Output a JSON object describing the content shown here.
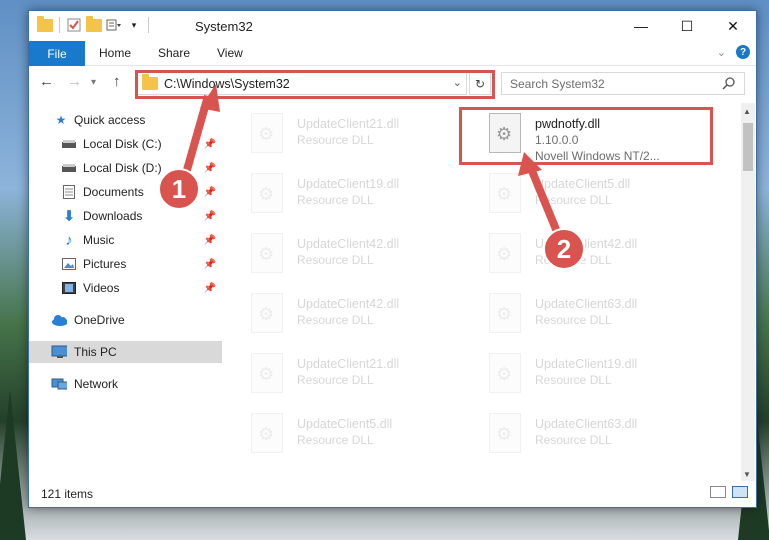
{
  "window": {
    "title": "System32",
    "controls": {
      "minimize": "—",
      "maximize": "☐",
      "close": "✕"
    }
  },
  "ribbon": {
    "tabs": [
      "File",
      "Home",
      "Share",
      "View"
    ],
    "help_label": "?"
  },
  "navigation": {
    "address": "C:\\Windows\\System32",
    "search_placeholder": "Search System32"
  },
  "sidebar": {
    "items": [
      {
        "label": "Quick access",
        "icon": "star-icon"
      },
      {
        "label": "Local Disk (C:)",
        "icon": "drive-icon"
      },
      {
        "label": "Local Disk (D:)",
        "icon": "drive-icon"
      },
      {
        "label": "Documents",
        "icon": "documents-icon"
      },
      {
        "label": "Downloads",
        "icon": "download-icon"
      },
      {
        "label": "Music",
        "icon": "music-icon"
      },
      {
        "label": "Pictures",
        "icon": "pictures-icon"
      },
      {
        "label": "Videos",
        "icon": "videos-icon"
      },
      {
        "label": "OneDrive",
        "icon": "cloud-icon"
      },
      {
        "label": "This PC",
        "icon": "computer-icon"
      },
      {
        "label": "Network",
        "icon": "network-icon"
      }
    ]
  },
  "files": [
    {
      "name": "UpdateClient21.dll",
      "type": "Resource DLL"
    },
    {
      "name": "pwdnotfy.dll",
      "type": "1.10.0.0",
      "company": "Novell Windows NT/2..."
    },
    {
      "name": "UpdateClient19.dll",
      "type": "Resource DLL"
    },
    {
      "name": "UpdateClient5.dll",
      "type": "Resource DLL"
    },
    {
      "name": "UpdateClient42.dll",
      "type": "Resource DLL"
    },
    {
      "name": "UpdateClient42.dll",
      "type": "Resource DLL"
    },
    {
      "name": "UpdateClient42.dll",
      "type": "Resource DLL"
    },
    {
      "name": "UpdateClient63.dll",
      "type": "Resource DLL"
    },
    {
      "name": "UpdateClient21.dll",
      "type": "Resource DLL"
    },
    {
      "name": "UpdateClient19.dll",
      "type": "Resource DLL"
    },
    {
      "name": "UpdateClient5.dll",
      "type": "Resource DLL"
    },
    {
      "name": "UpdateClient63.dll",
      "type": "Resource DLL"
    }
  ],
  "status": {
    "item_count": "121 items"
  },
  "annotations": {
    "marker1": "1",
    "marker2": "2"
  },
  "colors": {
    "accent": "#1979ca",
    "highlight": "#d9534f"
  }
}
